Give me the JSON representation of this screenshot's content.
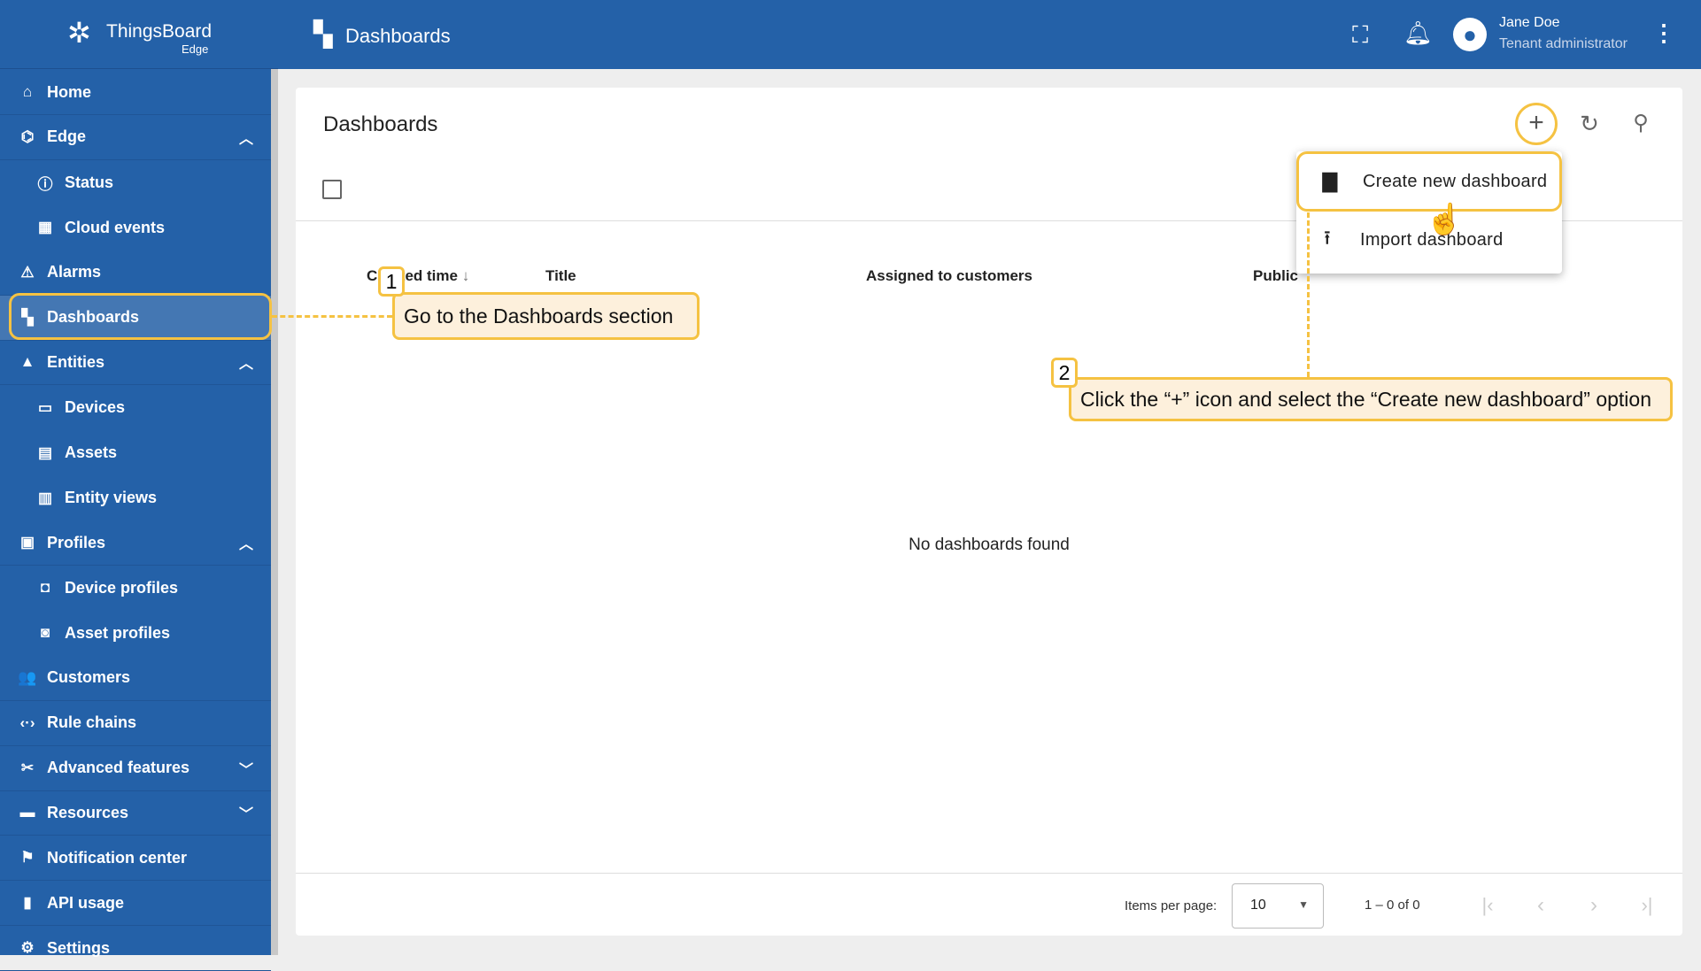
{
  "app": {
    "logo_text": "ThingsBoard",
    "logo_sub": "Edge"
  },
  "topbar": {
    "title": "Dashboards",
    "user_name": "Jane Doe",
    "user_role": "Tenant administrator",
    "icons": [
      "fullscreen-icon",
      "bell-icon",
      "account-icon",
      "more-vert-icon"
    ]
  },
  "sidebar": {
    "items": [
      {
        "label": "Home",
        "icon": "⌂"
      },
      {
        "label": "Edge",
        "icon": "⌬",
        "chevron": "up"
      },
      {
        "label": "Status",
        "icon": "ⓘ",
        "sub": true
      },
      {
        "label": "Cloud events",
        "icon": "▦",
        "sub": true
      },
      {
        "label": "Alarms",
        "icon": "⚠"
      },
      {
        "label": "Dashboards",
        "icon": "▚",
        "active": true
      },
      {
        "label": "Entities",
        "icon": "▲",
        "chevron": "up"
      },
      {
        "label": "Devices",
        "icon": "▭",
        "sub": true
      },
      {
        "label": "Assets",
        "icon": "▤",
        "sub": true
      },
      {
        "label": "Entity views",
        "icon": "▥",
        "sub": true
      },
      {
        "label": "Profiles",
        "icon": "▣",
        "chevron": "up"
      },
      {
        "label": "Device profiles",
        "icon": "◘",
        "sub": true
      },
      {
        "label": "Asset profiles",
        "icon": "◙",
        "sub": true
      },
      {
        "label": "Customers",
        "icon": "👥"
      },
      {
        "label": "Rule chains",
        "icon": "‹·›"
      },
      {
        "label": "Advanced features",
        "icon": "✂",
        "chevron": "down"
      },
      {
        "label": "Resources",
        "icon": "▬",
        "chevron": "down"
      },
      {
        "label": "Notification center",
        "icon": "⚑"
      },
      {
        "label": "API usage",
        "icon": "▮"
      },
      {
        "label": "Settings",
        "icon": "⚙"
      }
    ]
  },
  "card": {
    "title": "Dashboards",
    "columns": [
      "Created time",
      "Title",
      "Assigned to customers",
      "Public"
    ],
    "sort_indicator": "↓",
    "empty_text": "No dashboards found"
  },
  "menu": {
    "items": [
      "Create new dashboard",
      "Import dashboard"
    ]
  },
  "footer": {
    "items_per_page_label": "Items per page:",
    "items_per_page_value": "10",
    "range": "1 – 0 of 0"
  },
  "callouts": [
    {
      "number": "1",
      "text": "Go to the  Dashboards  section"
    },
    {
      "number": "2",
      "text": "Click the “+” icon and select the “Create new dashboard” option"
    }
  ],
  "colors": {
    "primary": "#2461a8",
    "highlight": "#f5c242",
    "callout_fill": "#fdf0dc"
  }
}
